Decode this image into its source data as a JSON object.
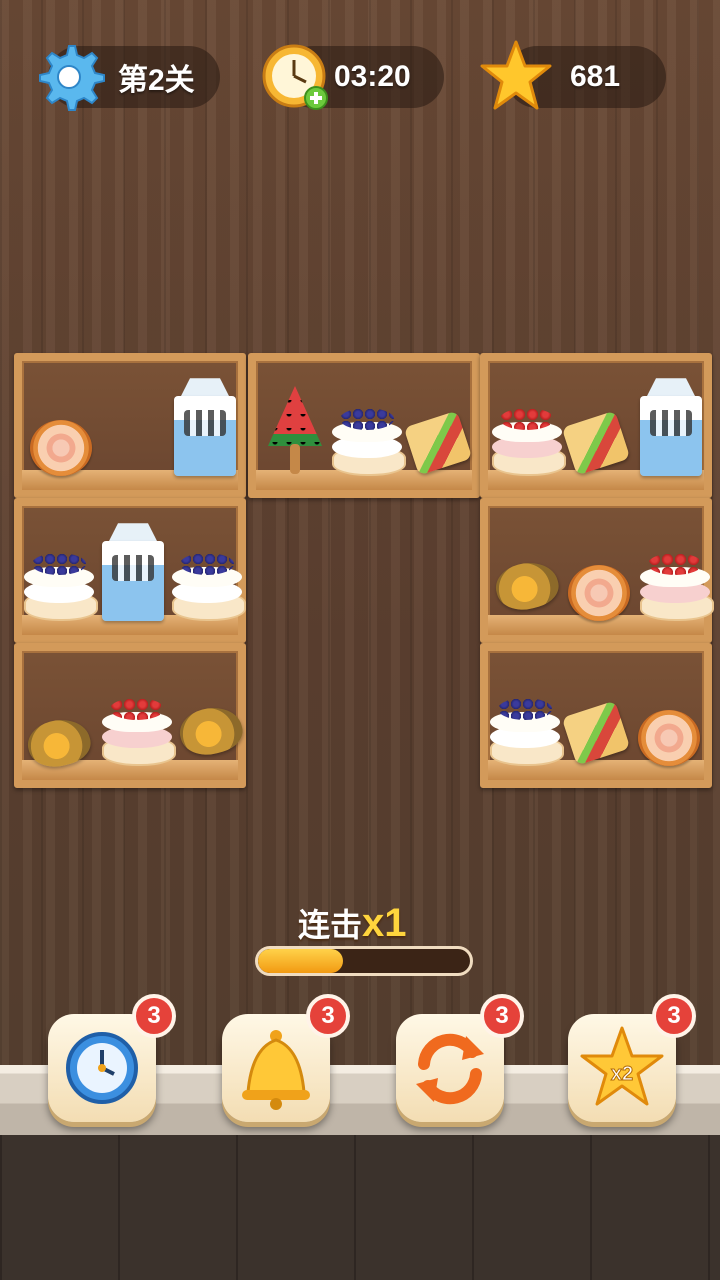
{
  "hud": {
    "level_label": "第2关",
    "timer": "03:20",
    "score": "681"
  },
  "shelves": [
    {
      "items": [
        "pizza",
        "milk-carton"
      ]
    },
    {
      "items": [
        "watermelon-popsicle",
        "blueberry-cake",
        "sandwich"
      ]
    },
    {
      "items": [
        "strawberry-cake",
        "sandwich",
        "milk-carton"
      ]
    },
    {
      "items": [
        "blueberry-cake",
        "milk-carton",
        "blueberry-cake"
      ]
    },
    {
      "items": [
        "croissant",
        "pizza",
        "strawberry-cake"
      ]
    },
    {
      "items": [
        "croissant",
        "strawberry-cake",
        "croissant"
      ]
    },
    {
      "items": [
        "blueberry-cake",
        "sandwich",
        "pizza"
      ]
    }
  ],
  "combo": {
    "label": "连击",
    "multiplier": "x1",
    "progress": 0.4
  },
  "powerups": [
    {
      "icon": "clock-icon",
      "count": "3"
    },
    {
      "icon": "bell-icon",
      "count": "3"
    },
    {
      "icon": "shuffle-icon",
      "count": "3"
    },
    {
      "icon": "star-x2-icon",
      "count": "3",
      "label": "x2"
    }
  ],
  "colors": {
    "badge": "#e5423a",
    "progress_fill": "#f29a12",
    "combo_multiplier": "#ffd53d"
  }
}
